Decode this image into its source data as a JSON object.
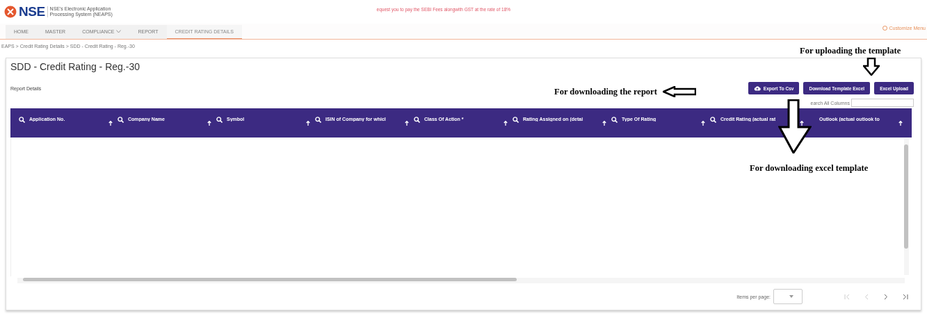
{
  "header": {
    "logo_text": "NSE",
    "logo_subtitle": "NSE's Electronic Application Processing System (NEAPS)",
    "notice": "equest you to pay the SEBI Fees alongwith GST at the rate of 18%"
  },
  "nav_tabs": [
    {
      "label": "HOME",
      "selected": false,
      "has_menu": false
    },
    {
      "label": "MASTER",
      "selected": false,
      "has_menu": false
    },
    {
      "label": "COMPLIANCE",
      "selected": false,
      "has_menu": true
    },
    {
      "label": "REPORT",
      "selected": false,
      "has_menu": false
    },
    {
      "label": "CREDIT RATING DETAILS",
      "selected": true,
      "has_menu": false
    }
  ],
  "customize_menu": "Customize Menu",
  "breadcrumb": "EAPS > Credit Rating Details > SDD - Credit Rating - Reg.-30",
  "page_title": "SDD - Credit Rating - Reg.-30",
  "section_label": "Report Details",
  "buttons": [
    {
      "label": "Export To Csv",
      "kind": "export"
    },
    {
      "label": "Download Template Excel",
      "kind": "plain"
    },
    {
      "label": "Excel Upload",
      "kind": "plain"
    }
  ],
  "search": {
    "label": "earch All Columns"
  },
  "table": {
    "columns": [
      {
        "label": "Application No.",
        "search_icon": true
      },
      {
        "label": "Company Name",
        "search_icon": true
      },
      {
        "label": "Symbol",
        "search_icon": true
      },
      {
        "label": "ISIN of Company for whicl",
        "search_icon": true
      },
      {
        "label": "Class Of Action *",
        "search_icon": true
      },
      {
        "label": "Rating Assigned on (detai",
        "search_icon": true
      },
      {
        "label": "Type Of Rating",
        "search_icon": true
      },
      {
        "label": "Credit Rating (actual rat",
        "search_icon": true
      },
      {
        "label": "Outlook (actual outlook to",
        "search_icon": false
      }
    ]
  },
  "pagination": {
    "items_per_page_label": "Items per page:"
  },
  "annotations": [
    {
      "text": "For uploading the template",
      "kind": "down"
    },
    {
      "text": "For downloading the report",
      "kind": "left"
    },
    {
      "text": "For downloading excel template",
      "kind": "bigdown"
    }
  ]
}
